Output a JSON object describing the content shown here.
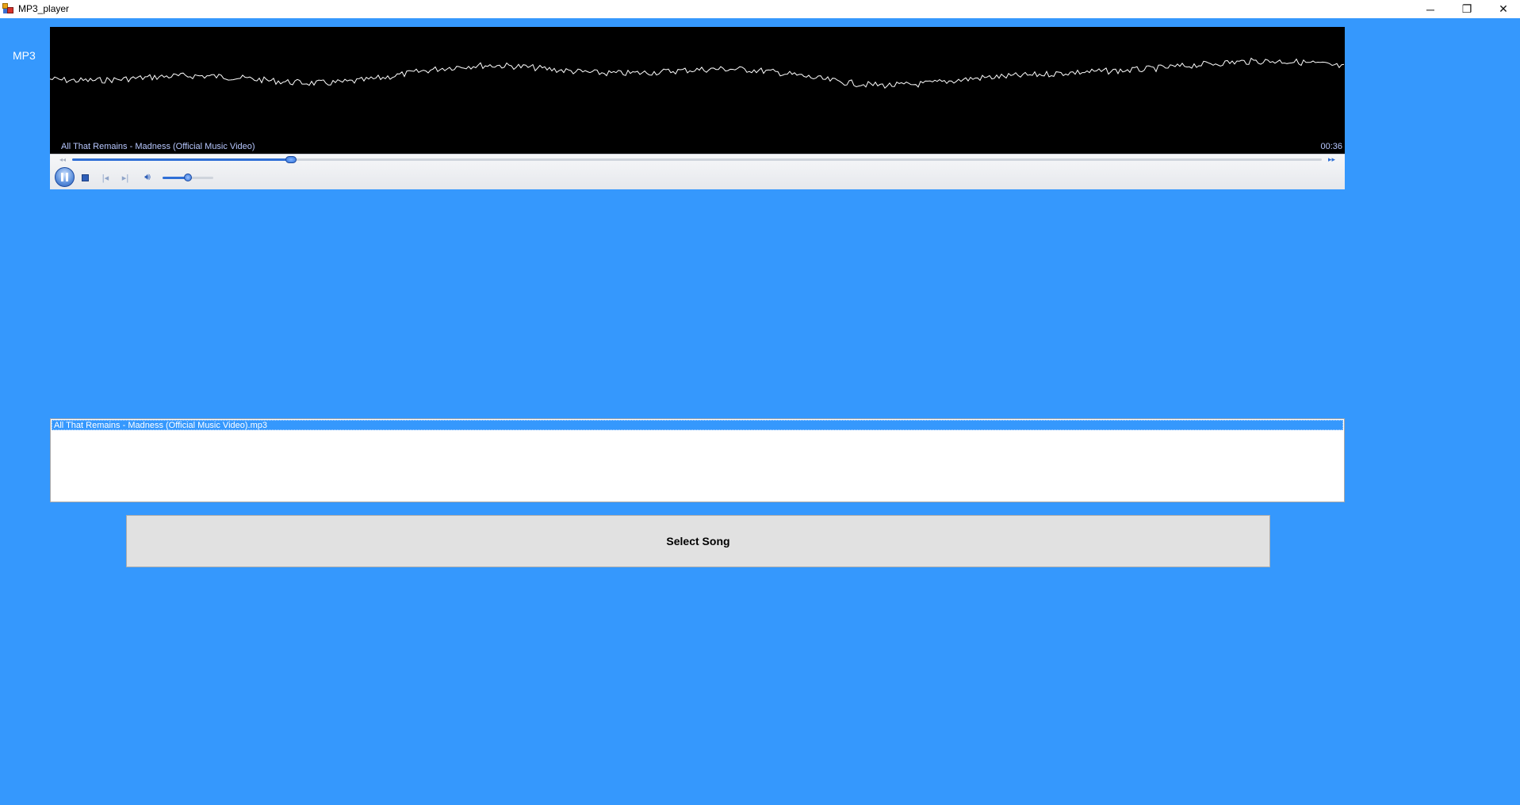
{
  "window": {
    "title": "MP3_player",
    "minimize_glyph": "─",
    "maximize_glyph": "❐",
    "close_glyph": "✕"
  },
  "app_label": "MP3",
  "player": {
    "now_playing": "All That Remains - Madness (Official Music Video)",
    "elapsed_time": "00:36",
    "seek_progress": 0.175,
    "volume_level": 0.5,
    "visualizer_color": "#ffffff",
    "accent_color": "#2f6fd6"
  },
  "playlist": {
    "items": [
      "All That Remains - Madness (Official Music Video).mp3"
    ],
    "selected_index": 0
  },
  "buttons": {
    "select_song": "Select Song"
  },
  "colors": {
    "background": "#3598fd",
    "button_bg": "#e1e1e1"
  }
}
